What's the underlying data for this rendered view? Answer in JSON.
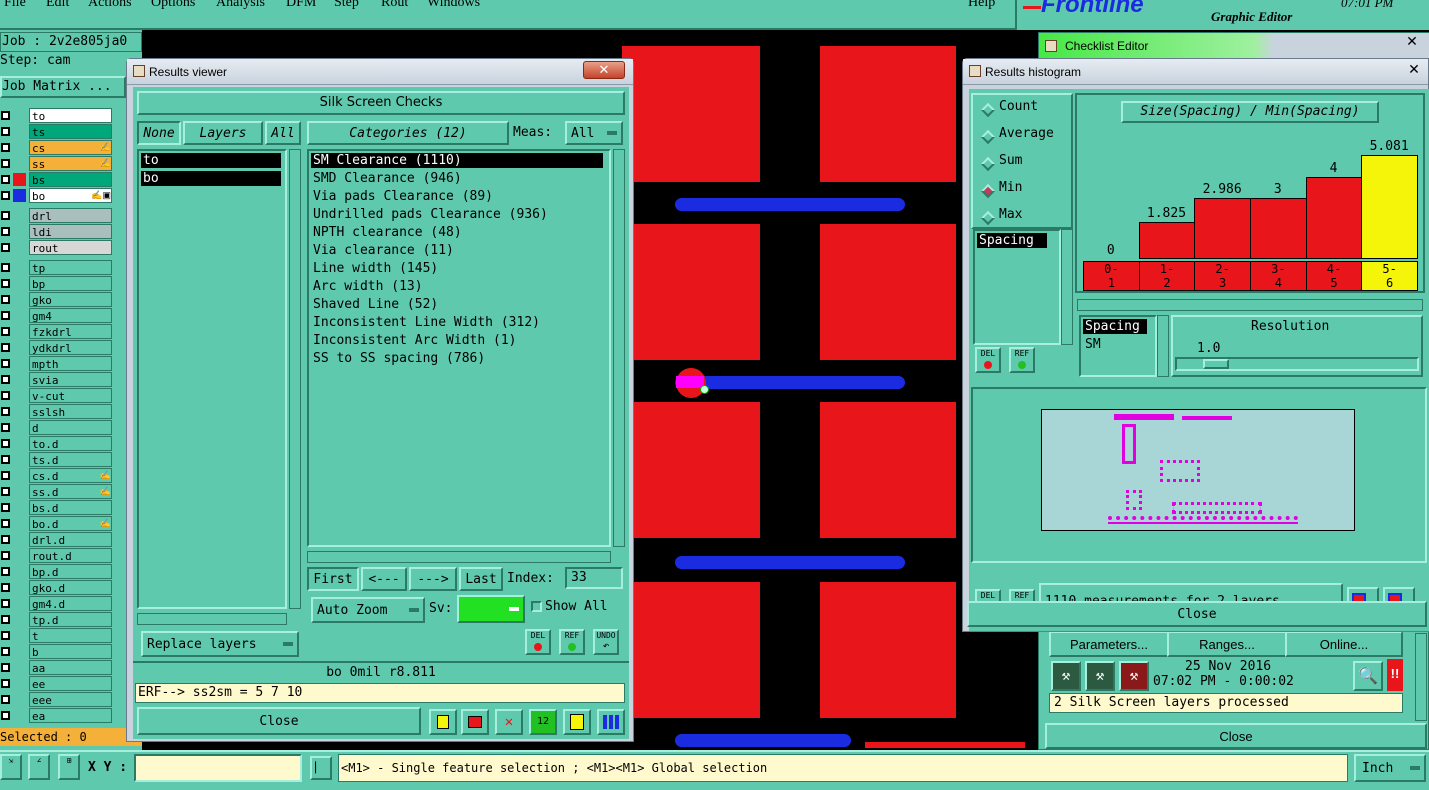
{
  "menu": [
    "File",
    "Edit",
    "Actions",
    "Options",
    "Analysis",
    "DFM",
    "Step",
    "Rout",
    "Windows"
  ],
  "menu_help": "Help",
  "brand": {
    "logo": "Frontline",
    "subtitle": "Graphic Editor",
    "time": "07:01 PM"
  },
  "job": {
    "job_line": "Job : 2v2e805ja0",
    "step_line": "Step: cam",
    "matrix_label": "Job Matrix ...",
    "selected": "Selected : 0"
  },
  "layers": [
    {
      "name": "to",
      "color": "#ffffff"
    },
    {
      "name": "ts",
      "color": "#00a77a"
    },
    {
      "name": "cs",
      "color": "#f5b03a",
      "mark": "✍"
    },
    {
      "name": "ss",
      "color": "#f5b03a",
      "mark": "✍"
    },
    {
      "name": "bs",
      "color": "#00a77a",
      "sw": "#e8161a"
    },
    {
      "name": "bo",
      "color": "#ffffff",
      "sw": "#1a2be0",
      "mark": "✍▣"
    },
    {
      "name": "drl",
      "color": "#a9bfbd",
      "gap": true
    },
    {
      "name": "ldi",
      "color": "#a9bfbd"
    },
    {
      "name": "rout",
      "color": "#d7d7d7"
    },
    {
      "name": "tp",
      "color": "#5fc9ad",
      "gap": true
    },
    {
      "name": "bp",
      "color": "#5fc9ad"
    },
    {
      "name": "gko",
      "color": "#5fc9ad"
    },
    {
      "name": "gm4",
      "color": "#5fc9ad"
    },
    {
      "name": "fzkdrl",
      "color": "#5fc9ad"
    },
    {
      "name": "ydkdrl",
      "color": "#5fc9ad"
    },
    {
      "name": "mpth",
      "color": "#5fc9ad"
    },
    {
      "name": "svia",
      "color": "#5fc9ad"
    },
    {
      "name": "v-cut",
      "color": "#5fc9ad"
    },
    {
      "name": "sslsh",
      "color": "#5fc9ad"
    },
    {
      "name": "d",
      "color": "#5fc9ad"
    },
    {
      "name": "to.d",
      "color": "#5fc9ad"
    },
    {
      "name": "ts.d",
      "color": "#5fc9ad"
    },
    {
      "name": "cs.d",
      "color": "#5fc9ad",
      "mark": "✍"
    },
    {
      "name": "ss.d",
      "color": "#5fc9ad",
      "mark": "✍"
    },
    {
      "name": "bs.d",
      "color": "#5fc9ad"
    },
    {
      "name": "bo.d",
      "color": "#5fc9ad",
      "mark": "✍"
    },
    {
      "name": "drl.d",
      "color": "#5fc9ad"
    },
    {
      "name": "rout.d",
      "color": "#5fc9ad"
    },
    {
      "name": "bp.d",
      "color": "#5fc9ad"
    },
    {
      "name": "gko.d",
      "color": "#5fc9ad"
    },
    {
      "name": "gm4.d",
      "color": "#5fc9ad"
    },
    {
      "name": "tp.d",
      "color": "#5fc9ad"
    },
    {
      "name": "t",
      "color": "#5fc9ad"
    },
    {
      "name": "b",
      "color": "#5fc9ad"
    },
    {
      "name": "aa",
      "color": "#5fc9ad"
    },
    {
      "name": "ee",
      "color": "#5fc9ad"
    },
    {
      "name": "eee",
      "color": "#5fc9ad"
    },
    {
      "name": "ea",
      "color": "#5fc9ad"
    }
  ],
  "results_viewer": {
    "title": "Results viewer",
    "header": "Silk Screen Checks",
    "none": "None",
    "layers": "Layers",
    "all": "All",
    "categories": "Categories (12)",
    "meas_label": "Meas:",
    "meas_value": "All",
    "layer_list": [
      "to",
      "bo"
    ],
    "category_list": [
      "SM Clearance (1110)",
      "SMD Clearance (946)",
      "Via pads Clearance (89)",
      "Undrilled pads Clearance (936)",
      "NPTH clearance (48)",
      "Via clearance (11)",
      "Line width (145)",
      "Arc width (13)",
      "Shaved Line (52)",
      "Inconsistent Line Width (312)",
      "Inconsistent Arc Width (1)",
      "SS to SS spacing (786)"
    ],
    "first": "First",
    "prev": "<---",
    "next": "--->",
    "last": "Last",
    "index_label": "Index:",
    "index_value": "33",
    "auto_zoom": "Auto Zoom",
    "sv": "Sv:",
    "show_all": "Show All",
    "replace": "Replace layers",
    "del": "DEL",
    "ref": "REF",
    "undo": "UNDO",
    "status": "bo  0mil   r8.811",
    "erf": "ERF--> ss2sm = 5 7 10",
    "close": "Close"
  },
  "checklist": {
    "title": "Checklist Editor",
    "params": "Parameters...",
    "ranges": "Ranges...",
    "online": "Online...",
    "date": "25 Nov 2016",
    "times": "07:02 PM   - 0:00:02",
    "processed": "2 Silk Screen layers processed",
    "close": "Close"
  },
  "histogram": {
    "title": "Results histogram",
    "modes": [
      "Count",
      "Average",
      "Sum",
      "Min",
      "Max"
    ],
    "selected_mode": "Min",
    "chart_title": "Size(Spacing) / Min(Spacing)",
    "list1": "Spacing",
    "list2a": "Spacing",
    "list2b": "SM",
    "resolution_label": "Resolution",
    "resolution_value": "1.0",
    "summary": "1110 measurements for 2 layers",
    "close": "Close",
    "del": "DEL",
    "ref": "REF"
  },
  "chart_data": {
    "type": "bar",
    "categories": [
      "0-\n1",
      "1-\n2",
      "2-\n3",
      "3-\n4",
      "4-\n5",
      "5-\n6"
    ],
    "values": [
      0,
      1.825,
      2.986,
      3,
      4,
      5.081
    ],
    "value_labels": [
      "0",
      "1.825",
      "2.986",
      "3",
      "4",
      "5.081"
    ],
    "colors": [
      "#e8161a",
      "#e8161a",
      "#e8161a",
      "#e8161a",
      "#e8161a",
      "#f5f50a"
    ],
    "title": "Size(Spacing) / Min(Spacing)",
    "ylim": [
      0,
      5.081
    ]
  },
  "bottom": {
    "xy_label": "X Y :",
    "hint": "<M1> - Single feature selection ; <M1><M1> Global selection",
    "units": "Inch"
  }
}
